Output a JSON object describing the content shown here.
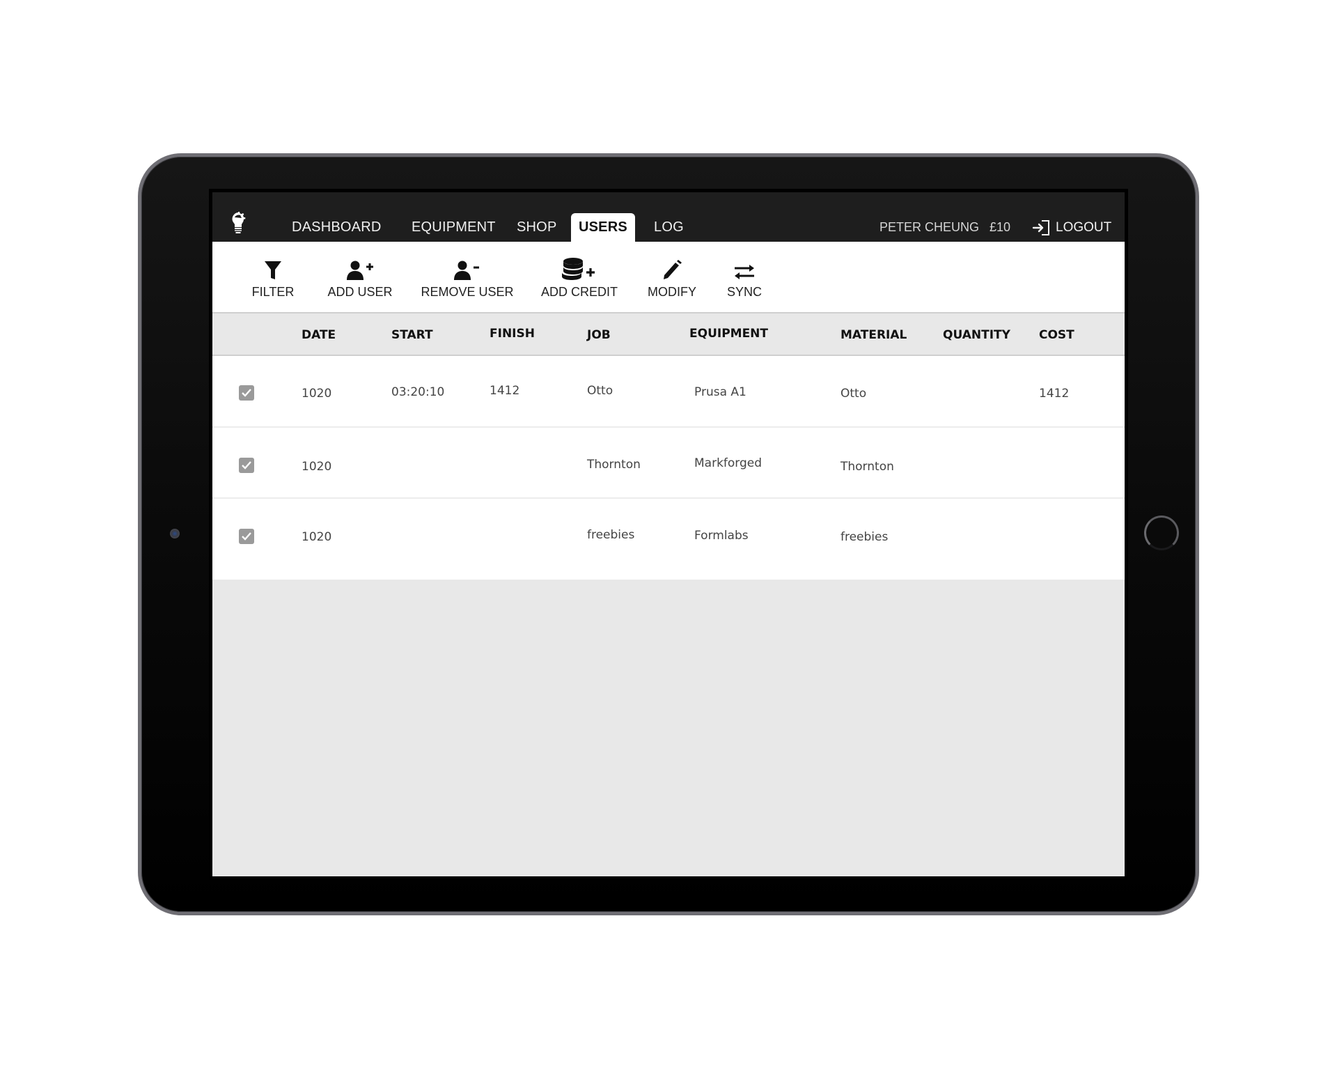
{
  "app": {
    "nav": {
      "tabs": [
        {
          "label": "DASHBOARD",
          "active": false
        },
        {
          "label": "EQUIPMENT",
          "active": false
        },
        {
          "label": "SHOP",
          "active": false
        },
        {
          "label": "USERS",
          "active": true
        },
        {
          "label": "LOG",
          "active": false
        }
      ],
      "user_name": "PETER CHEUNG",
      "credit": "£10",
      "logout_label": "LOGOUT"
    },
    "toolbar": [
      {
        "label": "FILTER",
        "icon": "filter-icon"
      },
      {
        "label": "ADD USER",
        "icon": "user-plus-icon"
      },
      {
        "label": "REMOVE USER",
        "icon": "user-minus-icon"
      },
      {
        "label": "ADD CREDIT",
        "icon": "coins-plus-icon"
      },
      {
        "label": "MODIFY",
        "icon": "pencil-icon"
      },
      {
        "label": "SYNC",
        "icon": "sync-arrows-icon"
      }
    ],
    "table": {
      "columns": [
        "DATE",
        "START",
        "FINISH",
        "JOB",
        "EQUIPMENT",
        "MATERIAL",
        "QUANTITY",
        "COST"
      ],
      "rows": [
        {
          "checked": true,
          "date": "1020",
          "start": "03:20:10",
          "finish": "1412",
          "job": "Otto",
          "equipment": "Prusa A1",
          "material": "Otto",
          "quantity": "",
          "cost": "1412"
        },
        {
          "checked": true,
          "date": "1020",
          "start": "",
          "finish": "",
          "job": "Thornton",
          "equipment": "Markforged",
          "material": "Thornton",
          "quantity": "",
          "cost": ""
        },
        {
          "checked": true,
          "date": "1020",
          "start": "",
          "finish": "",
          "job": "freebies",
          "equipment": "Formlabs",
          "material": "freebies",
          "quantity": "",
          "cost": ""
        }
      ]
    }
  },
  "colors": {
    "topbar": "#1e1e1e",
    "active_tab": "#ffffff",
    "checkbox": "#9a9a9a",
    "empty_area": "#e8e8e8"
  }
}
